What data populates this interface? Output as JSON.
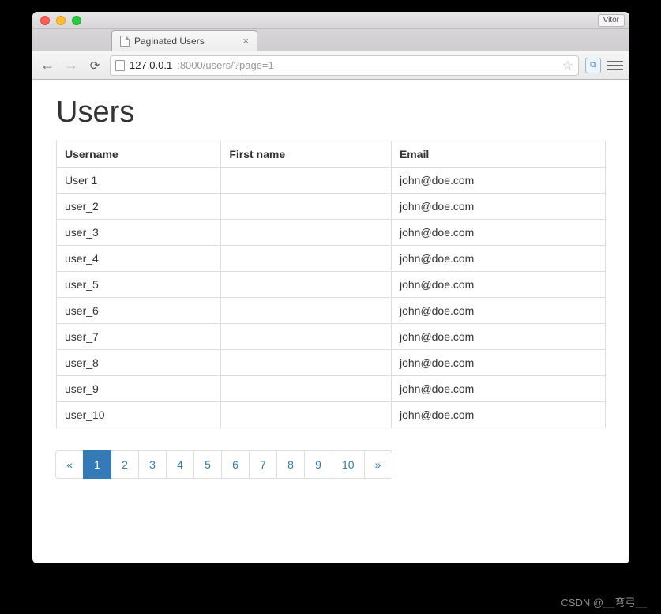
{
  "browser": {
    "profile_name": "Vitor",
    "tab_title": "Paginated Users",
    "url_host": "127.0.0.1",
    "url_port_path": ":8000/users/?page=1"
  },
  "page": {
    "heading": "Users",
    "columns": [
      "Username",
      "First name",
      "Email"
    ],
    "rows": [
      {
        "username": "User 1",
        "first_name": "",
        "email": "john@doe.com"
      },
      {
        "username": "user_2",
        "first_name": "",
        "email": "john@doe.com"
      },
      {
        "username": "user_3",
        "first_name": "",
        "email": "john@doe.com"
      },
      {
        "username": "user_4",
        "first_name": "",
        "email": "john@doe.com"
      },
      {
        "username": "user_5",
        "first_name": "",
        "email": "john@doe.com"
      },
      {
        "username": "user_6",
        "first_name": "",
        "email": "john@doe.com"
      },
      {
        "username": "user_7",
        "first_name": "",
        "email": "john@doe.com"
      },
      {
        "username": "user_8",
        "first_name": "",
        "email": "john@doe.com"
      },
      {
        "username": "user_9",
        "first_name": "",
        "email": "john@doe.com"
      },
      {
        "username": "user_10",
        "first_name": "",
        "email": "john@doe.com"
      }
    ]
  },
  "pagination": {
    "prev_symbol": "«",
    "next_symbol": "»",
    "active": 1,
    "pages": [
      1,
      2,
      3,
      4,
      5,
      6,
      7,
      8,
      9,
      10
    ]
  },
  "watermark": "CSDN @__弯弓__"
}
